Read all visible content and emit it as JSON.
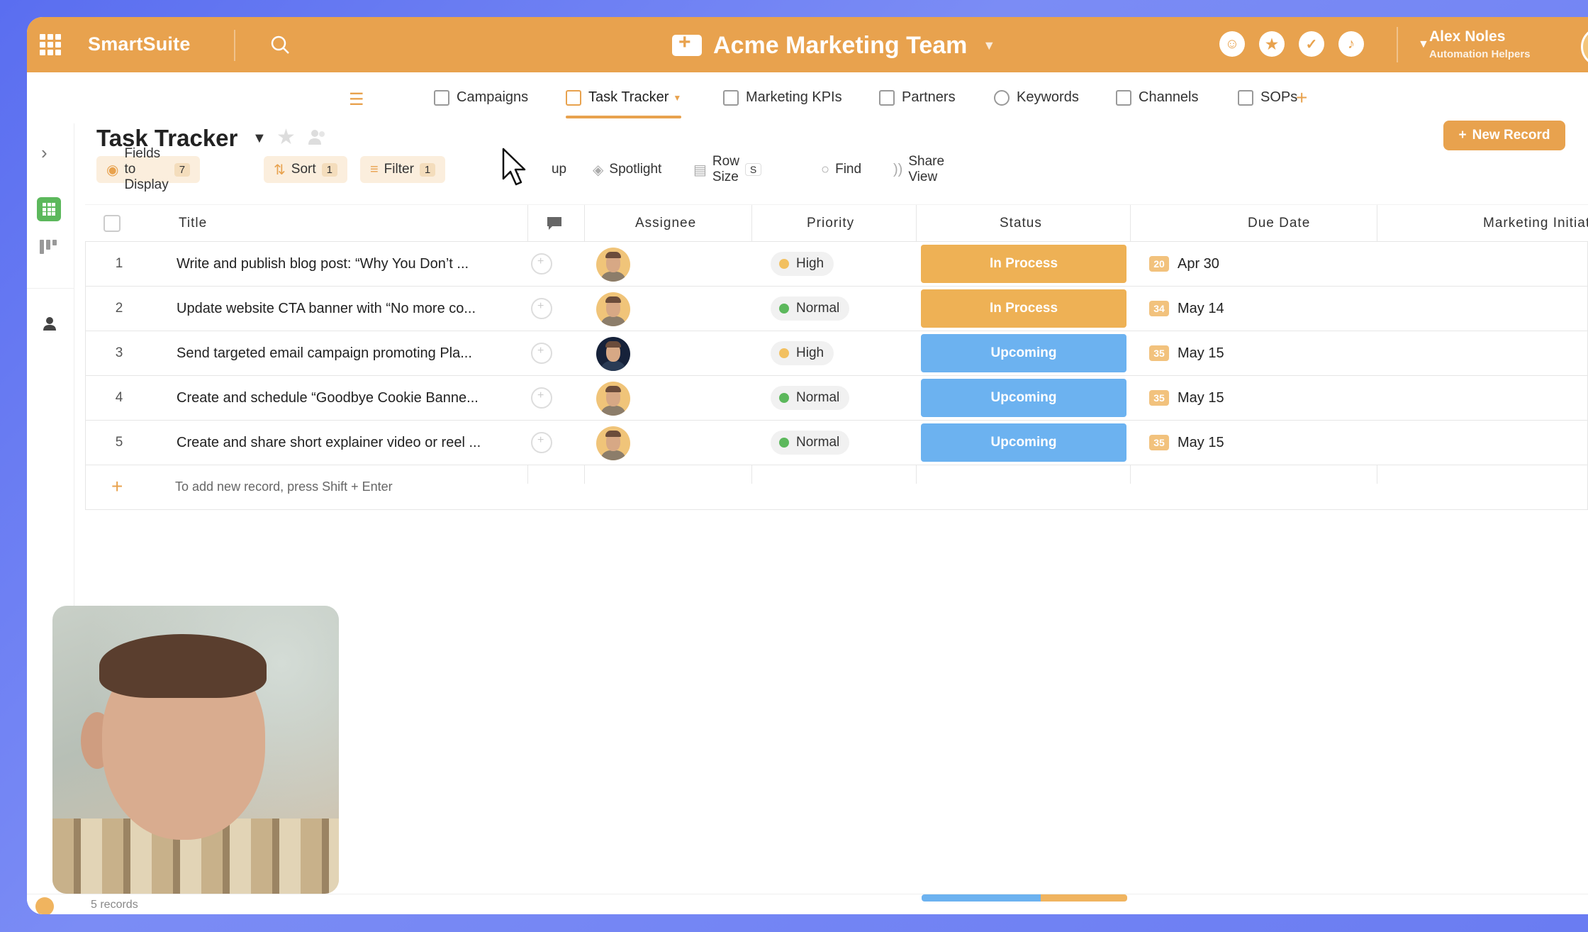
{
  "app": {
    "brand": "SmartSuite",
    "workspace_title": "Acme Marketing Team",
    "user_name": "Alex Noles",
    "user_subtitle": "Automation Helpers"
  },
  "tabs": [
    {
      "label": "Campaigns",
      "icon": "map-icon"
    },
    {
      "label": "Task Tracker",
      "icon": "checkbox-icon",
      "active": true
    },
    {
      "label": "Marketing KPIs",
      "icon": "bar-chart-icon"
    },
    {
      "label": "Partners",
      "icon": "handshake-icon"
    },
    {
      "label": "Keywords",
      "icon": "search-icon"
    },
    {
      "label": "Channels",
      "icon": "play-icon"
    },
    {
      "label": "SOPs",
      "icon": "book-icon"
    }
  ],
  "view": {
    "title": "Task Tracker",
    "new_record_label": "New Record"
  },
  "toolbar": {
    "fields_label": "Fields to Display",
    "fields_count": "7",
    "sort_label": "Sort",
    "sort_count": "1",
    "filter_label": "Filter",
    "filter_count": "1",
    "group_label": "up",
    "spotlight_label": "Spotlight",
    "rowsize_label": "Row Size",
    "rowsize_value": "S",
    "find_label": "Find",
    "share_label": "Share View"
  },
  "columns": {
    "title": "Title",
    "assignee": "Assignee",
    "priority": "Priority",
    "status": "Status",
    "due": "Due Date",
    "initiative": "Marketing Initiativ"
  },
  "rows": [
    {
      "num": "1",
      "title": "Write and publish blog post: “Why You Don’t ...",
      "priority": "High",
      "priority_color": "#f2c060",
      "status": "In Process",
      "status_color": "#eeb155",
      "days": "20",
      "due": "Apr 30",
      "assignee": "light"
    },
    {
      "num": "2",
      "title": "Update website CTA banner with “No more co...",
      "priority": "Normal",
      "priority_color": "#5cb85c",
      "status": "In Process",
      "status_color": "#eeb155",
      "days": "34",
      "due": "May 14",
      "assignee": "light"
    },
    {
      "num": "3",
      "title": "Send targeted email campaign promoting Pla...",
      "priority": "High",
      "priority_color": "#f2c060",
      "status": "Upcoming",
      "status_color": "#6cb2f0",
      "days": "35",
      "due": "May 15",
      "assignee": "dark"
    },
    {
      "num": "4",
      "title": "Create and schedule “Goodbye Cookie Banne...",
      "priority": "Normal",
      "priority_color": "#5cb85c",
      "status": "Upcoming",
      "status_color": "#6cb2f0",
      "days": "35",
      "due": "May 15",
      "assignee": "light"
    },
    {
      "num": "5",
      "title": "Create and share short explainer video or reel ...",
      "priority": "Normal",
      "priority_color": "#5cb85c",
      "status": "Upcoming",
      "status_color": "#6cb2f0",
      "days": "35",
      "due": "May 15",
      "assignee": "light"
    }
  ],
  "add_hint": "To add new record, press Shift + Enter",
  "footer": {
    "records": "5 records"
  },
  "colors": {
    "accent": "#e8a24e",
    "upcoming": "#6cb2f0",
    "in_process": "#eeb155"
  }
}
